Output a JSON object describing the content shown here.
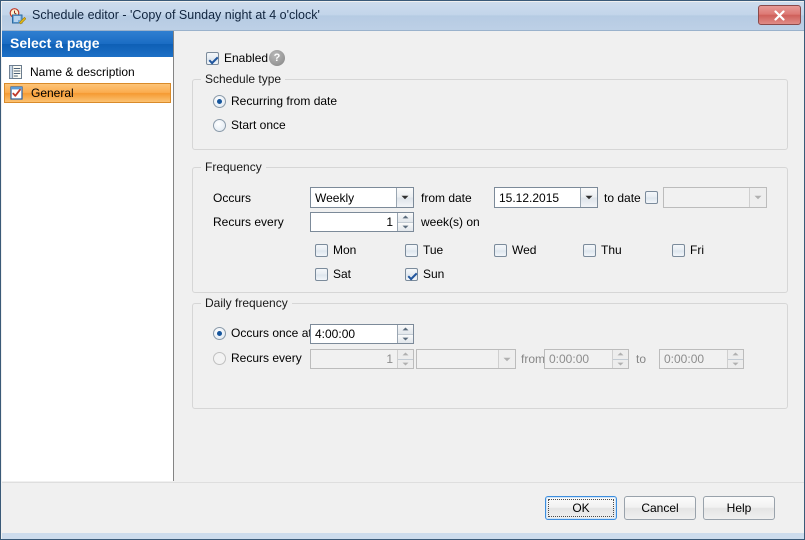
{
  "window": {
    "title": "Schedule editor - 'Copy of Sunday night at 4 o'clock'",
    "icon": "schedule-editor-icon",
    "close_label": "x"
  },
  "sidebar": {
    "header": "Select a page",
    "items": [
      {
        "label": "Name & description",
        "icon": "description-page-icon",
        "selected": false
      },
      {
        "label": "General",
        "icon": "general-page-icon",
        "selected": true
      }
    ]
  },
  "main": {
    "enabled_checkbox": {
      "label": "Enabled",
      "checked": true
    },
    "help_icon": "?",
    "schedule_type": {
      "title": "Schedule type",
      "options": [
        {
          "label": "Recurring from date",
          "selected": true
        },
        {
          "label": "Start once",
          "selected": false
        }
      ]
    },
    "frequency": {
      "title": "Frequency",
      "occurs_label": "Occurs",
      "occurs_value": "Weekly",
      "from_date_label": "from date",
      "from_date_value": "15.12.2015",
      "to_date_label": "to date",
      "to_date_checked": false,
      "to_date_value": "",
      "recurs_every_label": "Recurs every",
      "recurs_every_value": "1",
      "weeks_on_label": "week(s) on",
      "days": [
        {
          "label": "Mon",
          "checked": false
        },
        {
          "label": "Tue",
          "checked": false
        },
        {
          "label": "Wed",
          "checked": false
        },
        {
          "label": "Thu",
          "checked": false
        },
        {
          "label": "Fri",
          "checked": false
        },
        {
          "label": "Sat",
          "checked": false
        },
        {
          "label": "Sun",
          "checked": true
        }
      ]
    },
    "daily_frequency": {
      "title": "Daily frequency",
      "occurs_once_label": "Occurs once at",
      "occurs_once_selected": true,
      "occurs_once_value": "4:00:00",
      "recurs_every_label": "Recurs every",
      "recurs_every_selected": false,
      "recurs_every_value": "1",
      "interval_unit_value": "",
      "from_label": "from",
      "from_value": "0:00:00",
      "to_label": "to",
      "to_value": "0:00:00"
    }
  },
  "footer": {
    "ok_label": "OK",
    "cancel_label": "Cancel",
    "help_label": "Help"
  },
  "colors": {
    "titlebar": "#c3d5ea",
    "sidebar_header": "#1a6cc4",
    "selection": "#f59a32",
    "close_button": "#cf605b",
    "accent_blue": "#15559c"
  }
}
